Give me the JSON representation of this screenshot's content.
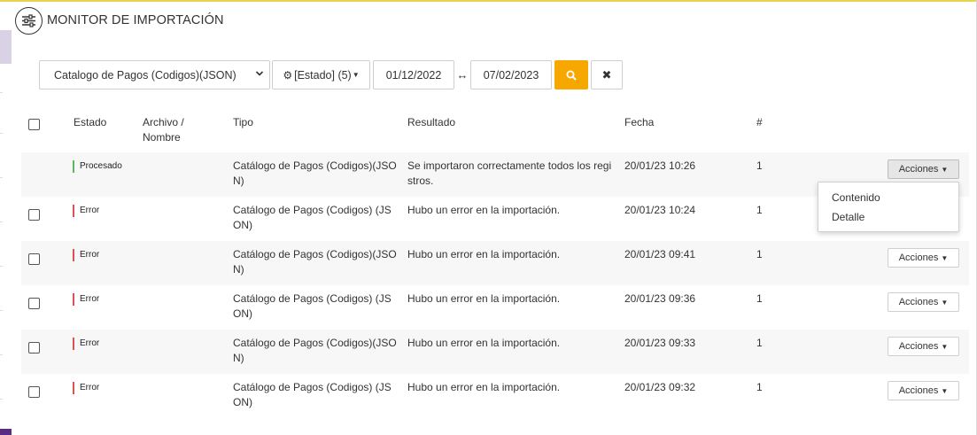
{
  "header": {
    "title": "MONITOR DE IMPORTACIÓN",
    "icon": "sliders-icon"
  },
  "toolbar": {
    "select_value": "Catalogo de Pagos (Codigos)(JSON)",
    "estado_label": "[Estado] (5)",
    "date_from": "01/12/2022",
    "date_sep": "↔",
    "date_to": "07/02/2023",
    "search_icon": "search-icon",
    "clear_label": "✖"
  },
  "table": {
    "headers": {
      "estado": "Estado",
      "archivo_line1": "Archivo /",
      "archivo_line2": "Nombre",
      "tipo": "Tipo",
      "resultado": "Resultado",
      "fecha": "Fecha",
      "num": "#"
    },
    "actions_label": "Acciones",
    "rows": [
      {
        "status": "Procesado",
        "status_color": "#5cb85c",
        "tipo": "Catálogo de Pagos (Codigos)(JSON)",
        "resultado": "Se importaron correctamente todos los registros.",
        "fecha": "20/01/23 10:26",
        "num": "1"
      },
      {
        "status": "Error",
        "status_color": "#d9534f",
        "tipo": "Catálogo de Pagos (Codigos) (JSON)",
        "resultado": "Hubo un error en la importación.",
        "fecha": "20/01/23 10:24",
        "num": "1"
      },
      {
        "status": "Error",
        "status_color": "#d9534f",
        "tipo": "Catálogo de Pagos (Codigos)(JSON)",
        "resultado": "Hubo un error en la importación.",
        "fecha": "20/01/23 09:41",
        "num": "1"
      },
      {
        "status": "Error",
        "status_color": "#d9534f",
        "tipo": "Catálogo de Pagos (Codigos) (JSON)",
        "resultado": "Hubo un error en la importación.",
        "fecha": "20/01/23 09:36",
        "num": "1"
      },
      {
        "status": "Error",
        "status_color": "#d9534f",
        "tipo": "Catálogo de Pagos (Codigos)(JSON)",
        "resultado": "Hubo un error en la importación.",
        "fecha": "20/01/23 09:33",
        "num": "1"
      },
      {
        "status": "Error",
        "status_color": "#d9534f",
        "tipo": "Catálogo de Pagos (Codigos) (JSON)",
        "resultado": "Hubo un error en la importación.",
        "fecha": "20/01/23 09:32",
        "num": "1"
      }
    ]
  },
  "dropdown": {
    "items": [
      "Contenido",
      "Detalle"
    ]
  },
  "colors": {
    "accent": "#f7a800",
    "brand": "#5b2c83",
    "success": "#5cb85c",
    "error": "#d9534f"
  }
}
